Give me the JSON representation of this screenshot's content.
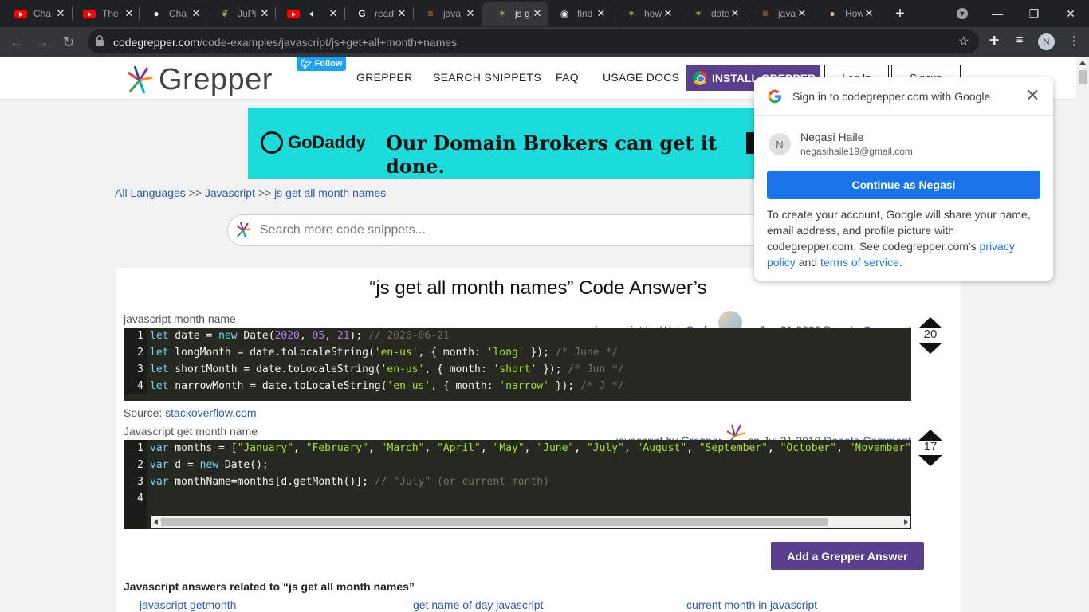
{
  "browser": {
    "tabs": [
      {
        "title": "Cha",
        "icon": "youtube-icon"
      },
      {
        "title": "The",
        "icon": "youtube-icon"
      },
      {
        "title": "Cha",
        "icon": "github-icon"
      },
      {
        "title": "JuPi",
        "icon": "leaf-icon"
      },
      {
        "title": "",
        "icon": "youtube-audio-icon"
      },
      {
        "title": "read",
        "icon": "google-icon"
      },
      {
        "title": "java",
        "icon": "stackoverflow-icon"
      },
      {
        "title": "js g",
        "icon": "grepper-icon",
        "active": true
      },
      {
        "title": "find",
        "icon": "globe-icon"
      },
      {
        "title": "how",
        "icon": "grepper-icon"
      },
      {
        "title": "date",
        "icon": "grepper-icon"
      },
      {
        "title": "java",
        "icon": "stackoverflow-icon"
      },
      {
        "title": "How",
        "icon": "avatar-icon"
      }
    ],
    "url_host": "codegrepper.com",
    "url_path": "/code-examples/javascript/js+get+all+month+names",
    "profile_initial": "N"
  },
  "header": {
    "logo_text": "Grepper",
    "twitter_follow": "Follow",
    "nav": [
      "GREPPER",
      "SEARCH SNIPPETS",
      "FAQ",
      "USAGE DOCS"
    ],
    "install_label": "INSTALL GREPPER",
    "login_label": "Log In",
    "signup_label": "Signup"
  },
  "ad": {
    "brand": "GoDaddy",
    "headline": "Our Domain Brokers can get it done."
  },
  "breadcrumbs": {
    "all_languages": "All Languages",
    "sep": ">>",
    "language": "Javascript",
    "current": "js get all month names"
  },
  "search": {
    "placeholder": "Search more code snippets..."
  },
  "main": {
    "title": "“js get all month names” Code Answer’s",
    "answers": [
      {
        "snippet_title": "javascript month name",
        "language": "javascript by",
        "author": "Web Surfer",
        "date": "on Jun 21 2020",
        "donate": "Donate",
        "comment": "Comment",
        "votes": "20",
        "source_label": "Source:",
        "source_link": "stackoverflow.com"
      },
      {
        "snippet_title": "Javascript get month name",
        "language": "javascript by",
        "author": "Grepper",
        "date": "on Jul 31 2019",
        "donate": "Donate",
        "comment": "Comment",
        "votes": "17"
      }
    ],
    "add_answer": "Add a Grepper Answer",
    "related_title": "Javascript answers related to “js get all month names”",
    "related_links": [
      "javascript getmonth",
      "get name of day javascript",
      "current month in javascript"
    ]
  },
  "google_popup": {
    "title": "Sign in to codegrepper.com with Google",
    "name": "Negasi Haile",
    "email": "negasihaile19@gmail.com",
    "avatar_initial": "N",
    "continue_label": "Continue as Negasi",
    "desc_text": "To create your account, Google will share your name, email address, and profile picture with codegrepper.com. See codegrepper.com's",
    "privacy_link": "privacy policy",
    "and_text": "and",
    "terms_link": "terms of service",
    "period": "."
  },
  "colors": {
    "accent_purple": "#5b3f8f",
    "link_blue": "#2a5db0",
    "google_blue": "#1a73e8",
    "code_bg": "#272822",
    "ad_bg": "#1bdbdb"
  }
}
